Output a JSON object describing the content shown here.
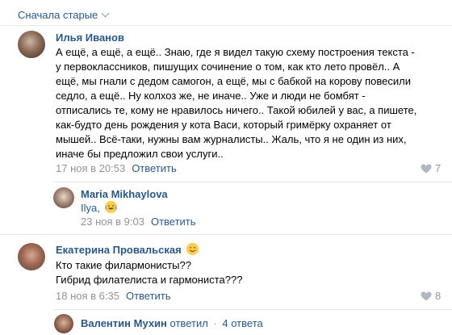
{
  "sort": {
    "label": "Сначала старые"
  },
  "comments": [
    {
      "author": "Илья Иванов",
      "text": "А ещё, а ещё, а ещё.. Знаю, где я видел такую схему построения текста -\nу первоклассников, пишущих сочинение о том, как кто лето провёл.. А\nещё, мы гнали с дедом самогон, а ещё, мы с бабкой на корову повесили\nседло, а ещё.. Ну колхоз же, не иначе.. Уже и люди не бомбят -\nотписались те, кому не нравилось ничего.. Такой юбилей у вас, а пишете,\nкак-будто день рождения у кота Васи, который гримёрку охраняет от\nмышей.. Всё-таки, нужны вам журналисты.. Жаль, что я не один из них,\nиначе бы предложил свои услуги..",
      "date": "17 ноя в 20:53",
      "reply": "Ответить",
      "likes": "7"
    },
    {
      "author": "Maria Mikhaylova",
      "text": "Ilya,",
      "emoji": "laughing-tears-emoji",
      "date": "23 ноя в 9:03",
      "reply": "Ответить"
    },
    {
      "author": "Екатерина Провальская",
      "emoji": "smiling-face-emoji",
      "text": "Кто такие филармонисты??\nГибрид филателиста и гармониста???",
      "date": "18 ноя в 6:35",
      "reply": "Ответить",
      "likes": "8"
    }
  ],
  "thread": {
    "author": "Валентин Мухин",
    "action": "ответил",
    "separator": "·",
    "count": "4 ответа"
  }
}
